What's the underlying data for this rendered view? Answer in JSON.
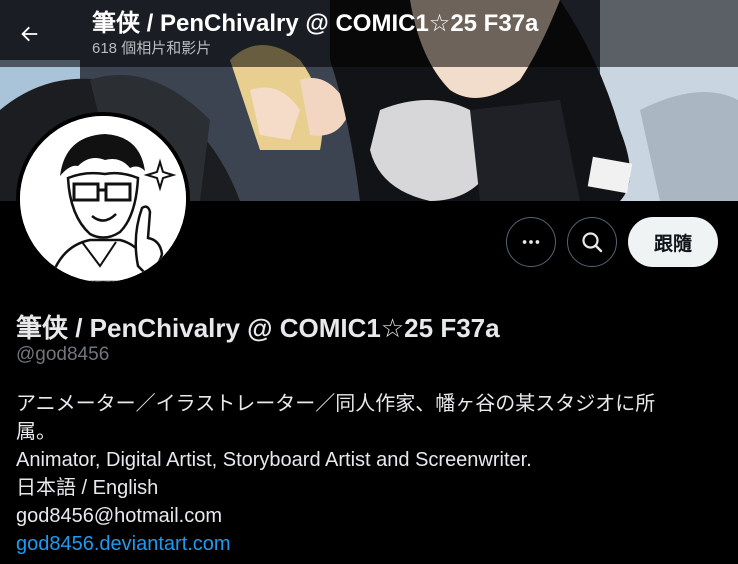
{
  "header": {
    "title": "筆侠 / PenChivalry @ COMIC1☆25 F37a",
    "subtitle": "618 個相片和影片"
  },
  "profile": {
    "display_name": "筆侠 / PenChivalry @ COMIC1☆25 F37a",
    "handle": "@god8456",
    "bio_lines": [
      "アニメーター／イラストレーター／同人作家、幡ヶ谷の某スタジオに所",
      "属。",
      "Animator, Digital Artist, Storyboard Artist and Screenwriter.",
      "日本語 / English",
      "god8456@hotmail.com"
    ],
    "link": "god8456.deviantart.com"
  },
  "actions": {
    "more_icon": "more-horizontal-icon",
    "search_icon": "search-icon",
    "follow_label": "跟隨"
  },
  "colors": {
    "background": "#000000",
    "text": "#e7e9ea",
    "muted": "#71767b",
    "link": "#1d9bf0",
    "follow_bg": "#eff3f4"
  }
}
